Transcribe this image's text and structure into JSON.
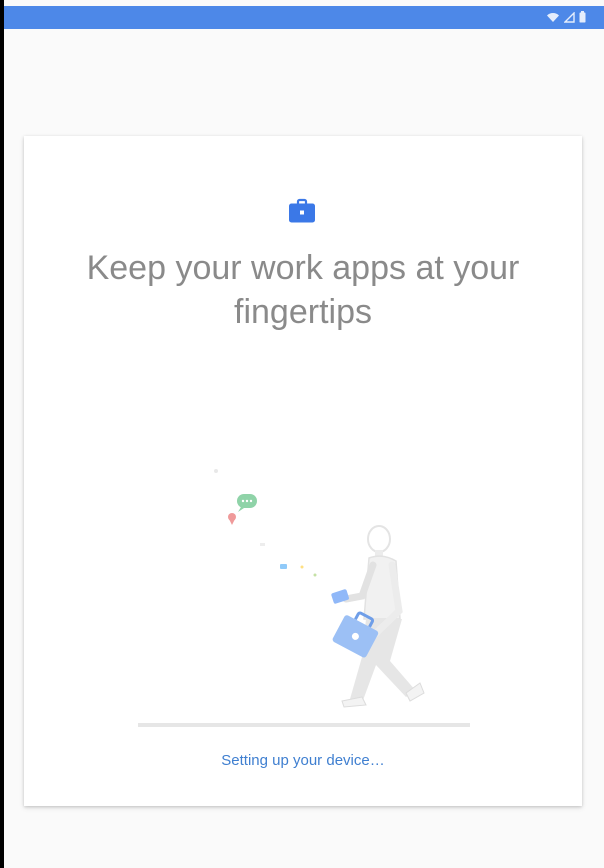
{
  "status_bar": {
    "icons": [
      "wifi-icon",
      "signal-icon",
      "battery-icon"
    ],
    "color": "#4d88e8"
  },
  "card": {
    "icon": "briefcase-icon",
    "headline": "Keep your work apps at your fingertips",
    "illustration": "person-walking-with-briefcase",
    "progress": {
      "value_fraction": 0.0,
      "indeterminate": true
    },
    "status_text": "Setting up your device…"
  },
  "colors": {
    "accent": "#4d88e8",
    "headline": "#8a8a8a",
    "status_text": "#3f7fd0",
    "background": "#fafafa"
  }
}
